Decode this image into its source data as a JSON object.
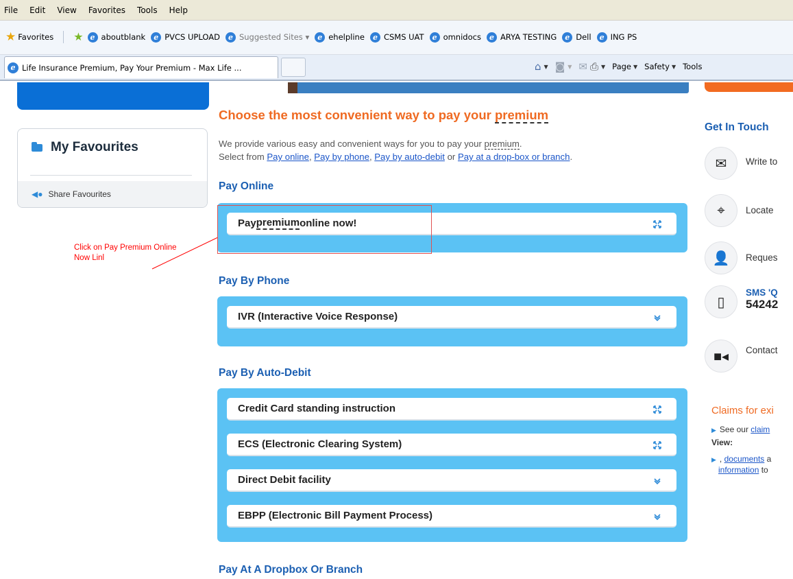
{
  "menu": [
    "File",
    "Edit",
    "View",
    "Favorites",
    "Tools",
    "Help"
  ],
  "favorites_bar": {
    "favorites_label": "Favorites",
    "links": [
      "aboutblank",
      "PVCS UPLOAD",
      "Suggested Sites ▾",
      "ehelpline",
      "CSMS UAT",
      "omnidocs",
      "ARYA TESTING",
      "Dell",
      "ING PS"
    ]
  },
  "tab": {
    "title": "Life Insurance Premium, Pay Your Premium - Max Life ..."
  },
  "command_bar": {
    "page": "Page",
    "safety": "Safety",
    "tools": "Tools"
  },
  "favourites_box": {
    "title": "My Favourites",
    "share": "Share Favourites"
  },
  "annotation": {
    "line1": "Click on Pay Premium Online",
    "line2": "Now Linl"
  },
  "main": {
    "title_prefix": "Choose the most convenient way to pay your ",
    "title_term": "premium",
    "intro_line1_prefix": "We provide various easy and convenient ways for you to pay your ",
    "intro_line1_term": "premium",
    "intro_line1_suffix": ".",
    "intro_line2_prefix": "Select from ",
    "link_pay_online": "Pay online",
    "comma1": ", ",
    "link_pay_phone": "Pay by phone",
    "comma2": ", ",
    "link_auto_debit": "Pay by auto-debit",
    "or": " or ",
    "link_dropbox": "Pay at a drop-box or branch",
    "period": "."
  },
  "sections": {
    "online": {
      "title": "Pay Online",
      "item_prefix": "Pay ",
      "item_term": "premium",
      "item_suffix": " online now!"
    },
    "phone": {
      "title": "Pay By Phone",
      "items": [
        "IVR (Interactive Voice Response)"
      ]
    },
    "auto_debit": {
      "title": "Pay By Auto-Debit",
      "items": [
        "Credit Card standing instruction",
        "ECS (Electronic Clearing System)",
        "Direct Debit facility",
        "EBPP (Electronic Bill Payment Process)"
      ]
    },
    "dropbox": {
      "title": "Pay At A Dropbox Or Branch"
    }
  },
  "get_in_touch": {
    "title": "Get In Touch",
    "write": "Write to",
    "locate": "Locate",
    "request": "Reques",
    "sms_line1": "SMS 'Q",
    "sms_line2": "54242",
    "contact": "Contact"
  },
  "claims": {
    "title": "Claims for exi",
    "see_our": "See our ",
    "claim_link": "claim",
    "view": "View:",
    "docs_prefix": ", ",
    "docs_link": "documents",
    "docs_suffix": " a",
    "info_link": "information",
    "info_suffix": " to"
  },
  "colors": {
    "accent_orange": "#ef6a22",
    "heading_blue": "#1b5fb2",
    "panel_blue": "#5bc2f4",
    "annotation_red": "#ff0000"
  }
}
